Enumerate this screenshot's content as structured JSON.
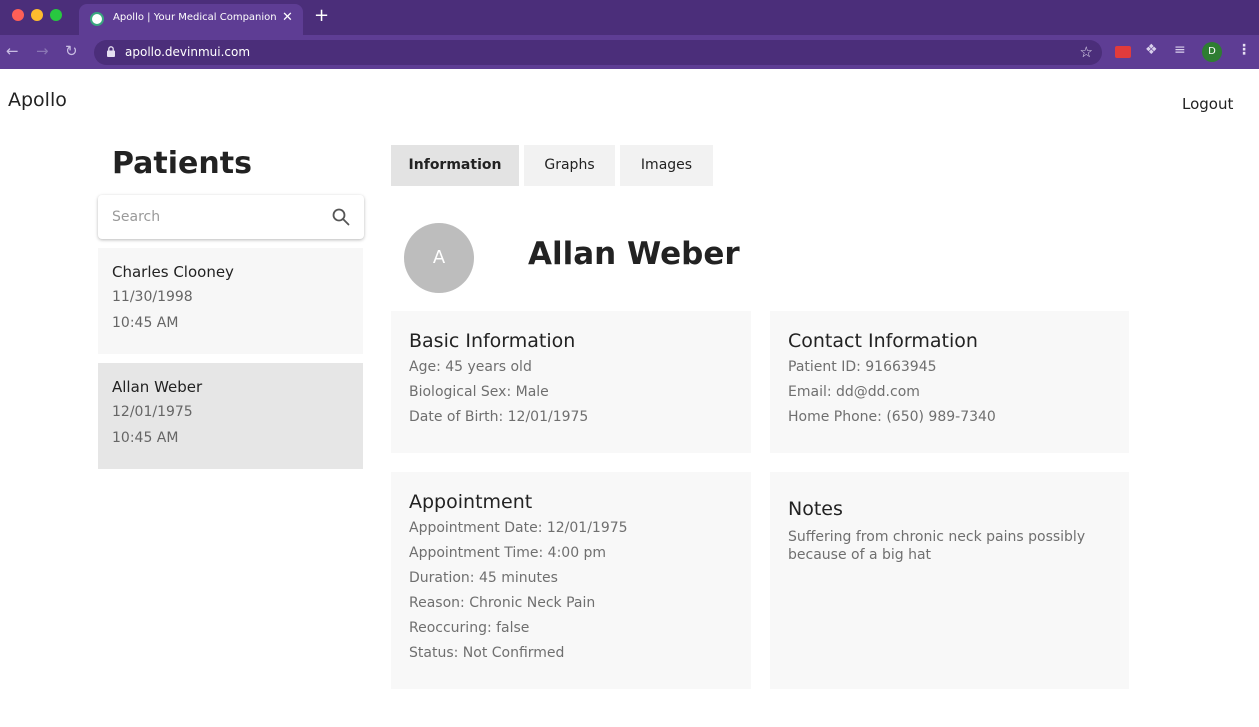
{
  "browser": {
    "tab_title": "Apollo | Your Medical Companion",
    "tab_close": "✕",
    "new_tab": "+",
    "url": "apollo.devinmui.com",
    "profile_initial": "D"
  },
  "app": {
    "brand": "Apollo",
    "logout_label": "Logout"
  },
  "sidebar": {
    "title": "Patients",
    "search_placeholder": "Search",
    "patients": [
      {
        "name": "Charles Clooney",
        "date": "11/30/1998",
        "time": "10:45 AM",
        "selected": false
      },
      {
        "name": "Allan Weber",
        "date": "12/01/1975",
        "time": "10:45 AM",
        "selected": true
      }
    ]
  },
  "tabs": [
    {
      "label": "Information",
      "active": true
    },
    {
      "label": "Graphs",
      "active": false
    },
    {
      "label": "Images",
      "active": false
    }
  ],
  "patient": {
    "avatar_initial": "A",
    "name": "Allan Weber"
  },
  "basic_info": {
    "title": "Basic Information",
    "lines": [
      "Age: 45 years old",
      "Biological Sex: Male",
      "Date of Birth: 12/01/1975"
    ]
  },
  "contact_info": {
    "title": "Contact Information",
    "lines": [
      "Patient ID: 91663945",
      "Email: dd@dd.com",
      "Home Phone: (650) 989-7340"
    ]
  },
  "appointment": {
    "title": "Appointment",
    "lines": [
      "Appointment Date: 12/01/1975",
      "Appointment Time: 4:00 pm",
      "Duration: 45 minutes",
      "Reason: Chronic Neck Pain",
      "Reoccuring: false",
      "Status: Not Confirmed"
    ]
  },
  "notes": {
    "title": "Notes",
    "text": "Suffering from chronic neck pains possibly because of a big hat"
  },
  "colors": {
    "browser_frame": "#4b2e7a",
    "browser_toolbar": "#5e3d94",
    "selected_card": "#e6e6e6",
    "panel_bg": "#f8f8f8",
    "avatar_bg": "#bdbdbd"
  }
}
